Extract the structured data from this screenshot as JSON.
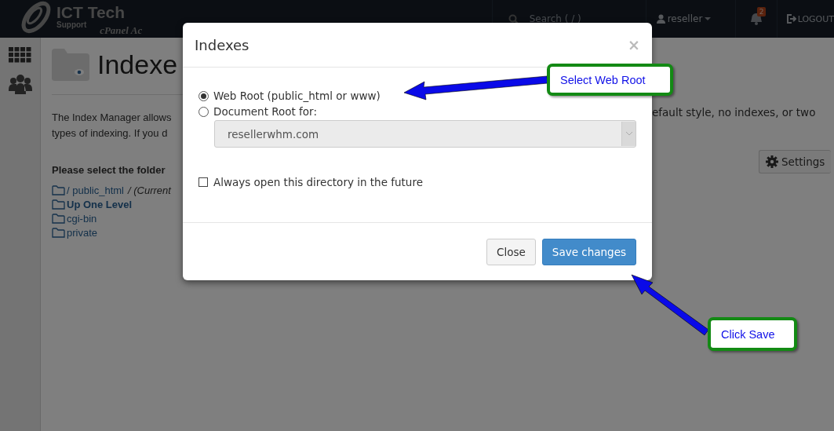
{
  "header": {
    "logo_title": "ICT Tech",
    "logo_subtitle": "Support",
    "tagline": "cPanel Ac",
    "search": {
      "placeholder": "Search ( / )"
    },
    "user": "reseller",
    "notifications": {
      "count": "2"
    },
    "logout": "LOGOUT"
  },
  "page": {
    "title": "Indexe",
    "description": [
      "The Index Manager allows",
      "types of indexing. If you d"
    ],
    "description_right": "efault style, no indexes, or two",
    "folder_prompt": "Please select the folder",
    "folders": [
      {
        "name": "/ public_html",
        "suffix": "/ (Current",
        "kind": "current"
      },
      {
        "name": "Up One Level",
        "kind": "parent"
      },
      {
        "name": "cgi-bin",
        "kind": "folder"
      },
      {
        "name": "private",
        "kind": "folder"
      }
    ],
    "settings_button": "Settings"
  },
  "modal": {
    "title": "Indexes",
    "close": "×",
    "options": [
      {
        "label": "Web Root (public_html or www)",
        "selected": true
      },
      {
        "label": "Document Root for:",
        "selected": false
      }
    ],
    "domain_select": {
      "value": "resellerwhm.com",
      "disabled": true
    },
    "always_open": {
      "label": "Always open this directory in the future",
      "checked": false
    },
    "buttons": [
      {
        "label": "Close",
        "kind": "default"
      },
      {
        "label": "Save changes",
        "kind": "primary"
      }
    ]
  },
  "annotations": [
    {
      "text": "Select Web Root"
    },
    {
      "text": "Click Save"
    }
  ]
}
